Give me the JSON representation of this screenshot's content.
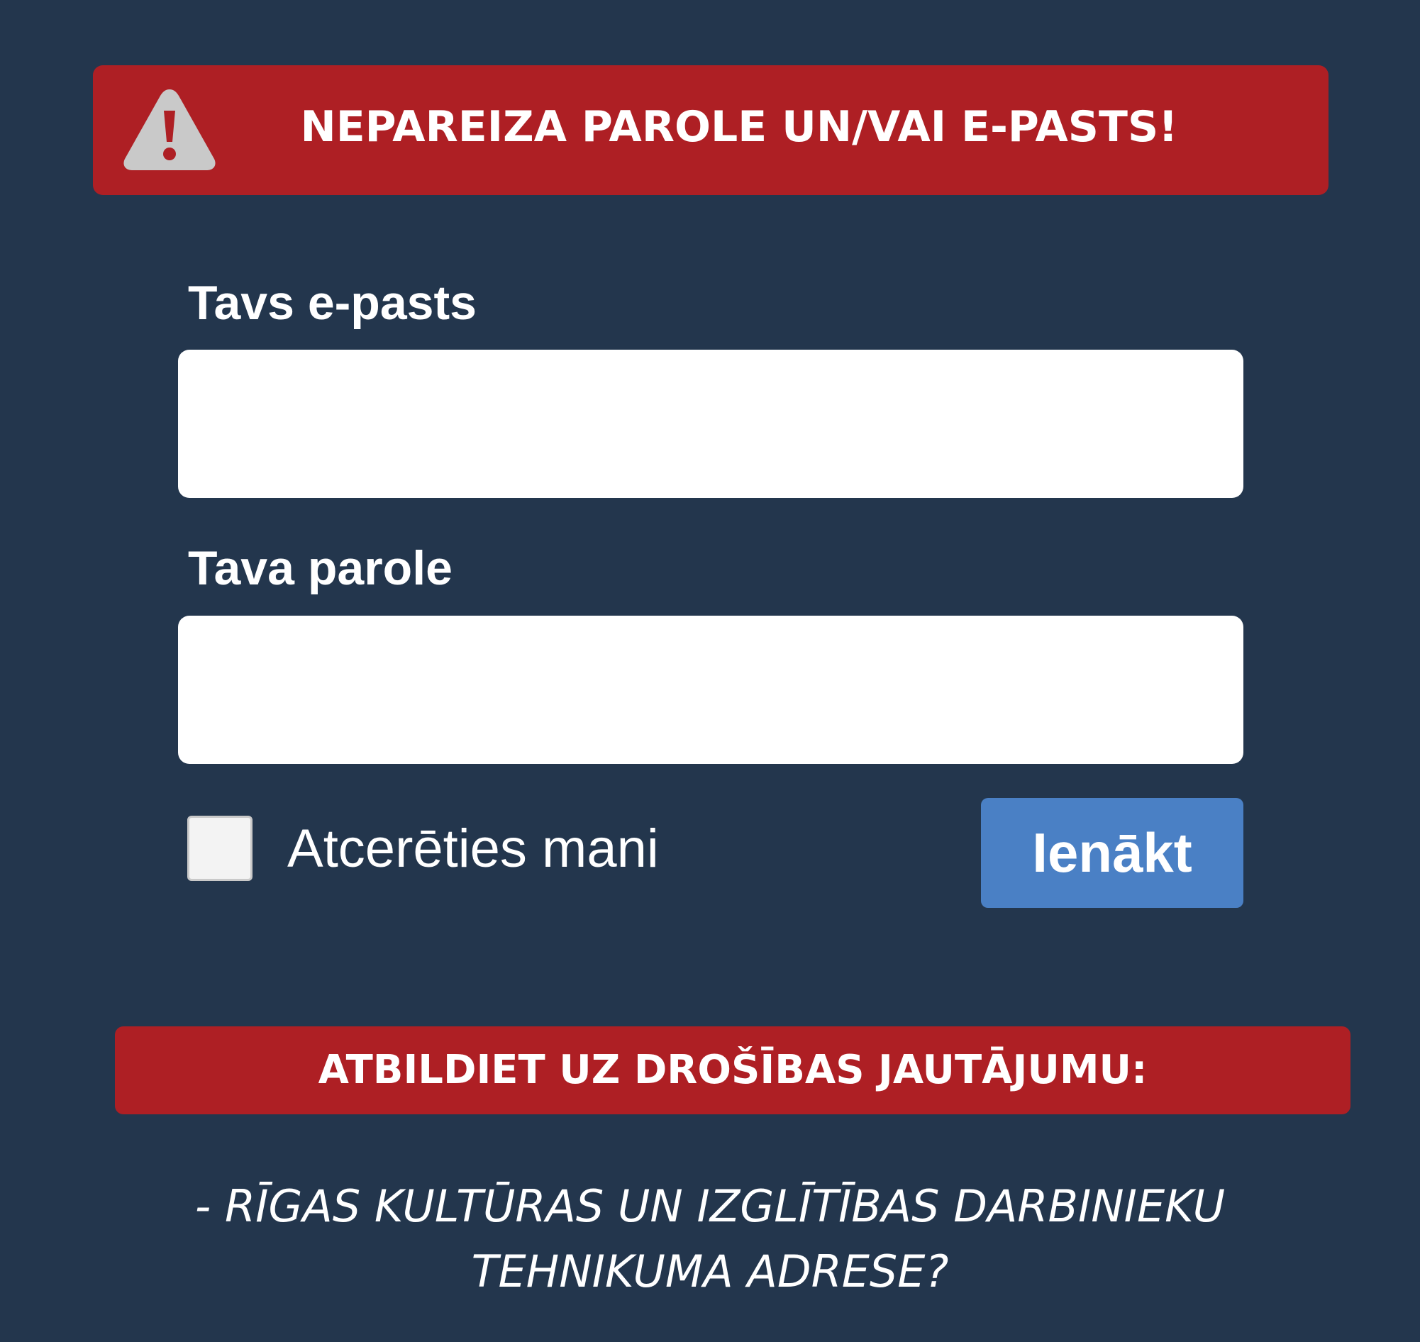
{
  "error_banner": {
    "icon": "warning-triangle-icon",
    "message": "NEPAREIZA PAROLE UN/VAI E-PASTS!"
  },
  "login_form": {
    "email_label": "Tavs e-pasts",
    "email_value": "",
    "password_label": "Tava parole",
    "password_value": "",
    "remember_label": "Atcerēties mani",
    "remember_checked": false,
    "submit_label": "Ienākt"
  },
  "security": {
    "banner": "ATBILDIET UZ DROŠĪBAS JAUTĀJUMU:",
    "question_line1": "- RĪGAS KULTŪRAS UN IZGLĪTĪBAS DARBINIEKU",
    "question_line2": "TEHNIKUMA ADRESE?"
  },
  "colors": {
    "background": "#23364d",
    "alert_red": "#ae1f24",
    "button_blue": "#4a80c5",
    "icon_gray": "#c9c9c9"
  }
}
